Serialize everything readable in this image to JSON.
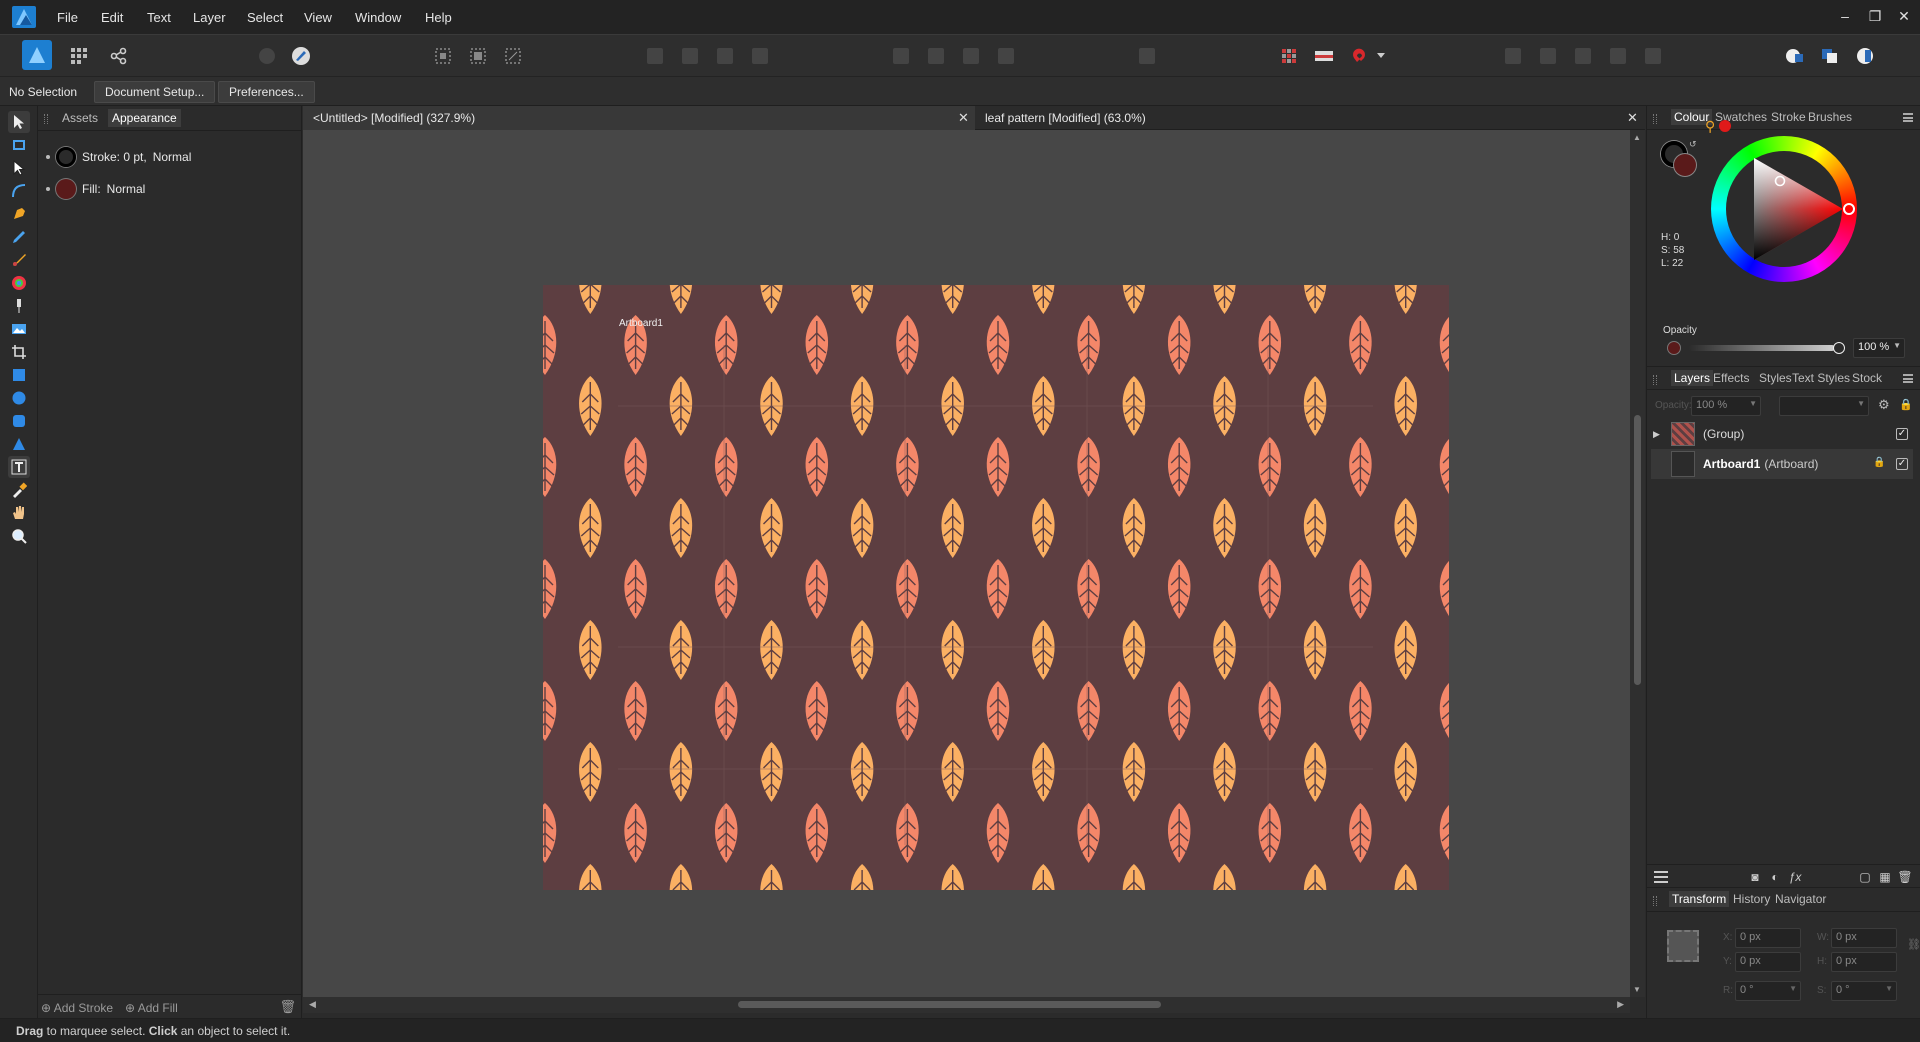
{
  "menu": [
    "File",
    "Edit",
    "Text",
    "Layer",
    "Select",
    "View",
    "Window",
    "Help"
  ],
  "context_bar": {
    "selection": "No Selection",
    "document_setup": "Document Setup...",
    "preferences": "Preferences..."
  },
  "left_panel": {
    "tabs": [
      "Assets",
      "Appearance"
    ],
    "stroke_label": "Stroke: 0 pt,",
    "stroke_mode": "Normal",
    "fill_label": "Fill:",
    "fill_mode": "Normal",
    "add_stroke": "Add Stroke",
    "add_fill": "Add Fill"
  },
  "documents": [
    {
      "title": "<Untitled> [Modified] (327.9%)",
      "active": true
    },
    {
      "title": "leaf pattern [Modified] (63.0%)",
      "active": false
    }
  ],
  "artboard": {
    "label": "Artboard1",
    "background": "#5d3e41",
    "leaf_colors": [
      "#f48769",
      "#fbb063"
    ]
  },
  "colour_panel": {
    "tabs": [
      "Colour",
      "Swatches",
      "Stroke",
      "Brushes"
    ],
    "h": "H: 0",
    "s": "S: 58",
    "l": "L: 22",
    "opacity_label": "Opacity",
    "opacity_value": "100 %",
    "fill_color": "#5a1a1a"
  },
  "layers_panel": {
    "tabs": [
      "Layers",
      "Effects",
      "Styles",
      "Text Styles",
      "Stock"
    ],
    "opacity_label": "Opacity:",
    "opacity_value": "100 %",
    "layers": [
      {
        "name": "(Group)",
        "suffix": "",
        "bold": false
      },
      {
        "name": "Artboard1",
        "suffix": "(Artboard)",
        "bold": true
      }
    ]
  },
  "transform_panel": {
    "tabs": [
      "Transform",
      "History",
      "Navigator"
    ],
    "x": "0 px",
    "y": "0 px",
    "w": "0 px",
    "h": "0 px",
    "r": "0 °",
    "s": "0 °",
    "x_label": "X:",
    "y_label": "Y:",
    "w_label": "W:",
    "h_label": "H:",
    "r_label": "R:",
    "s_label": "S:"
  },
  "status": {
    "drag": "Drag",
    "text1": " to marquee select. ",
    "click": "Click",
    "text2": " an object to select it."
  }
}
